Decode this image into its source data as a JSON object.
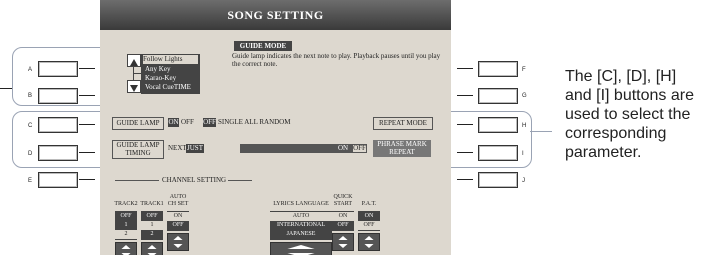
{
  "screen": {
    "title": "SONG SETTING",
    "guide_mode": {
      "heading": "GUIDE MODE",
      "description": "Guide lamp indicates the next note to play. Playback pauses until you play the correct note.",
      "options": [
        "Follow Lights",
        "Any Key",
        "Karao-Key",
        "Vocal CueTIME"
      ],
      "selected": "Follow Lights"
    },
    "row1": {
      "label": "GUIDE LAMP",
      "on": "ON",
      "off": "OFF",
      "off2": "OFF",
      "repeat_options": "SINGLE ALL RANDOM",
      "repeat_mode": "REPEAT MODE"
    },
    "row2": {
      "label": "GUIDE LAMP TIMING",
      "next": "NEXT",
      "just": "JUST",
      "on": "ON",
      "off": "OFF",
      "phrase": "PHRASE MARK REPEAT"
    },
    "channel_setting": {
      "heading": "CHANNEL SETTING",
      "columns": [
        {
          "header": "TRACK2",
          "values": [
            "OFF",
            "1",
            "2"
          ],
          "selected": "2"
        },
        {
          "header": "TRACK1",
          "values": [
            "OFF",
            "1",
            "2"
          ],
          "selected": "1"
        },
        {
          "header": "AUTO CH SET",
          "values": [
            "ON",
            "OFF"
          ],
          "selected": "ON"
        },
        {
          "header": "LYRICS LANGUAGE",
          "values": [
            "AUTO",
            "INTERNATIONAL",
            "JAPANESE"
          ],
          "selected": "AUTO"
        },
        {
          "header": "QUICK START",
          "values": [
            "ON",
            "OFF"
          ],
          "selected": "ON"
        },
        {
          "header": "P.A.T.",
          "values": [
            "ON",
            "OFF"
          ],
          "selected": "OFF"
        }
      ]
    }
  },
  "left_buttons": [
    "A",
    "B",
    "C",
    "D",
    "E"
  ],
  "right_buttons": [
    "F",
    "G",
    "H",
    "I",
    "J"
  ],
  "description": "The [C], [D], [H] and [I] buttons are used to select the corresponding parameter."
}
